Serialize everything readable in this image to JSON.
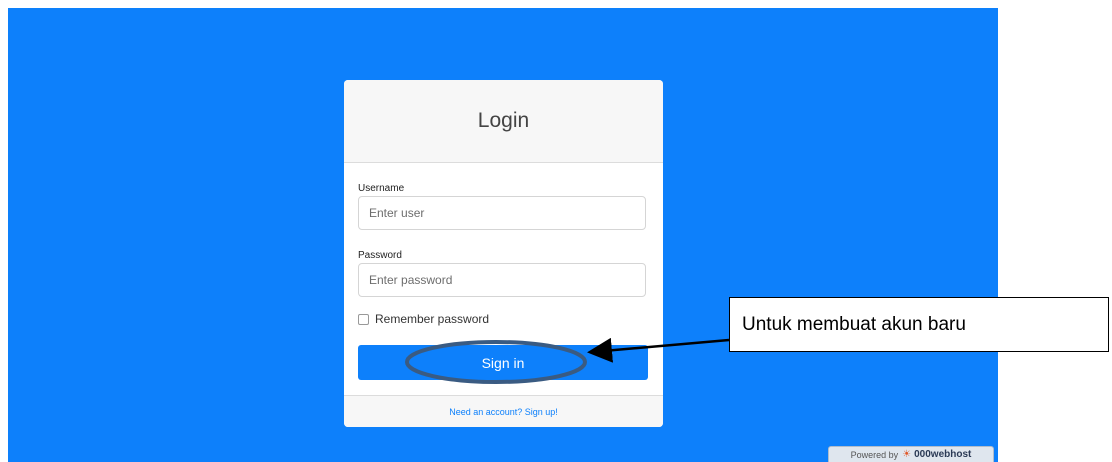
{
  "login": {
    "title": "Login",
    "username_label": "Username",
    "username_placeholder": "Enter user",
    "password_label": "Password",
    "password_placeholder": "Enter password",
    "remember_label": "Remember password",
    "signin_label": "Sign in",
    "signup_link": "Need an account? Sign up!"
  },
  "annotation": {
    "callout_text": "Untuk membuat akun baru"
  },
  "badge": {
    "powered_by": "Powered by",
    "host_name": "000webhost",
    "icon": "000webhost-logo-icon"
  },
  "colors": {
    "background": "#0d80fb",
    "primary": "#0d80fb",
    "card": "#ffffff"
  }
}
